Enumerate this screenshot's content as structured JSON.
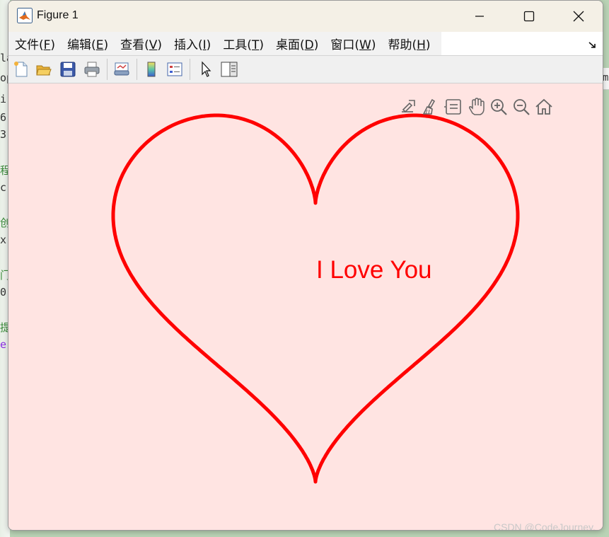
{
  "window": {
    "title": "Figure 1",
    "minimize_glyph": "—",
    "close_glyph": "✕"
  },
  "menu": [
    {
      "label": "文件(",
      "acc": "F",
      "end": ")"
    },
    {
      "label": "编辑(",
      "acc": "E",
      "end": ")"
    },
    {
      "label": "查看(",
      "acc": "V",
      "end": ")"
    },
    {
      "label": "插入(",
      "acc": "I",
      "end": ")"
    },
    {
      "label": "工具(",
      "acc": "T",
      "end": ")"
    },
    {
      "label": "桌面(",
      "acc": "D",
      "end": ")"
    },
    {
      "label": "窗口(",
      "acc": "W",
      "end": ")"
    },
    {
      "label": "帮助(",
      "acc": "H",
      "end": ")"
    }
  ],
  "toolbar_icons": [
    "new-figure-icon",
    "open-file-icon",
    "save-icon",
    "print-icon",
    "link-plot-icon",
    "colorbar-icon",
    "legend-icon",
    "edit-plot-icon",
    "property-inspector-icon"
  ],
  "axes_toolbar_icons": [
    "export-icon",
    "brush-icon",
    "data-tips-icon",
    "pan-icon",
    "zoom-in-icon",
    "zoom-out-icon",
    "home-icon"
  ],
  "annotation": "I Love You",
  "watermark": "CSDN @CodeJourney.",
  "colors": {
    "curve": "#ff0000",
    "figure_bg": "#ffe4e2",
    "text": "#ff0000"
  },
  "background_editor": {
    "chars": [
      "i",
      "6",
      "3",
      "程",
      "c",
      "创",
      "x",
      "门",
      "0",
      "提",
      "e"
    ],
    "top_chars": [
      "la",
      "op"
    ],
    "right_char": "m"
  }
}
